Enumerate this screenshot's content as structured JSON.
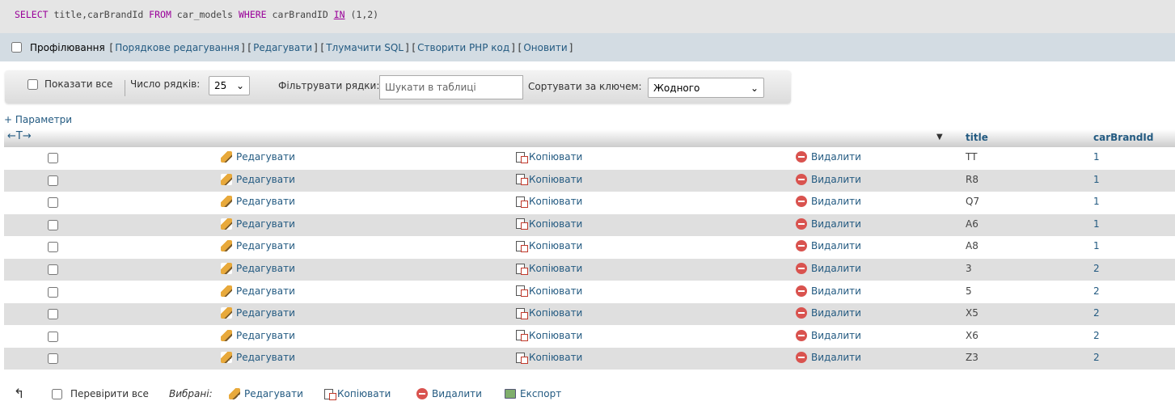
{
  "sql": {
    "tokens": [
      {
        "text": "SELECT",
        "kind": "kw"
      },
      {
        "text": " title,carBrandId ",
        "kind": "plain"
      },
      {
        "text": "FROM",
        "kind": "kw"
      },
      {
        "text": " car_models ",
        "kind": "plain"
      },
      {
        "text": "WHERE",
        "kind": "kw"
      },
      {
        "text": " carBrandID ",
        "kind": "plain"
      },
      {
        "text": "IN",
        "kind": "kw-u"
      },
      {
        "text": " (1,2)",
        "kind": "plain"
      }
    ]
  },
  "toolbar": {
    "profiling_label": "Профілювання",
    "links": [
      "Порядкове редагування",
      "Редагувати",
      "Тлумачити SQL",
      "Створити PHP код",
      "Оновити"
    ]
  },
  "nav": {
    "show_all_label": "Показати все",
    "rows_label": "Число рядків:",
    "rows_value": "25",
    "filter_label": "Фільтрувати рядки:",
    "filter_placeholder": "Шукати в таблиці",
    "sort_label": "Сортувати за ключем:",
    "sort_value": "Жодного"
  },
  "params_link": "+ Параметри",
  "table": {
    "arrows": "←T→",
    "columns": [
      "title",
      "carBrandId"
    ],
    "edit_label": "Редагувати",
    "copy_label": "Копіювати",
    "delete_label": "Видалити",
    "rows": [
      {
        "title": "TT",
        "carBrandId": "1"
      },
      {
        "title": "R8",
        "carBrandId": "1"
      },
      {
        "title": "Q7",
        "carBrandId": "1"
      },
      {
        "title": "A6",
        "carBrandId": "1"
      },
      {
        "title": "A8",
        "carBrandId": "1"
      },
      {
        "title": "3",
        "carBrandId": "2"
      },
      {
        "title": "5",
        "carBrandId": "2"
      },
      {
        "title": "X5",
        "carBrandId": "2"
      },
      {
        "title": "X6",
        "carBrandId": "2"
      },
      {
        "title": "Z3",
        "carBrandId": "2"
      }
    ]
  },
  "footer": {
    "check_all_label": "Перевірити все",
    "selected_label": "Вибрані:",
    "edit_label": "Редагувати",
    "copy_label": "Копіювати",
    "delete_label": "Видалити",
    "export_label": "Експорт"
  }
}
